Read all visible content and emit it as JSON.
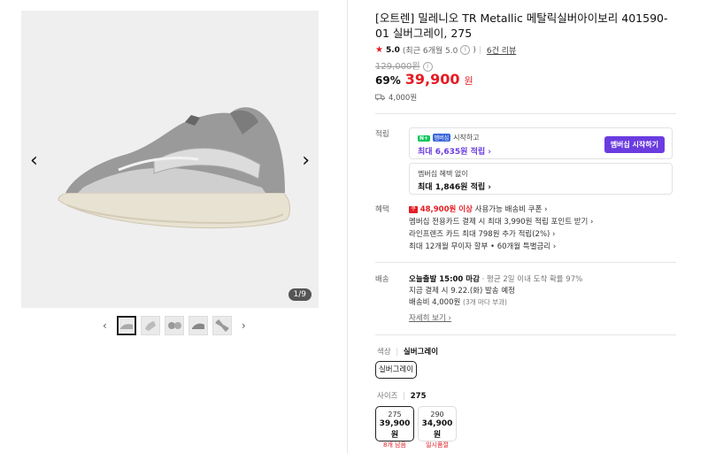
{
  "gallery": {
    "counter": "1/9",
    "prev_icon": "‹",
    "next_icon": "›",
    "thumb_prev_icon": "‹",
    "thumb_next_icon": "›",
    "thumbnail_count": 5
  },
  "product": {
    "title": "[오트렌] 밀레니오 TR Metallic 메탈릭실버아이보리 401590-01 실버그레이, 275",
    "rating_star": "★",
    "rating_score": "5.0",
    "rating_recent": "(최근 6개월 5.0",
    "rating_recent_close": ")",
    "review_link": "6건 리뷰",
    "original_price": "129,000원",
    "discount": "69%",
    "price": "39,900",
    "price_unit": "원",
    "points": "4,000원"
  },
  "accumulate": {
    "label": "적립",
    "membership_badge": "N+",
    "membership_tag": "멤버십",
    "membership_text": "시작하고",
    "membership_max": "최대 6,635원 적립 ›",
    "join_button": "멤버십 시작하기",
    "no_member_text": "멤버십 혜택 없이",
    "no_member_max": "최대 1,846원 적립 ›"
  },
  "benefits": {
    "label": "혜택",
    "coupon_tag": "쿠",
    "coupon_amount": "48,900원 이상",
    "coupon_text": "사용가능 배송비 쿠폰 ›",
    "line2": "멤버십 전용카드 결제 시 최대 3,990원 적립 포인트 받기 ›",
    "line3": "라인프렌즈 카드 최대 798원 추가 적립(2%) ›",
    "line4": "최대 12개월 무이자 할부 • 60개월 특별금리 ›"
  },
  "shipping": {
    "label": "배송",
    "today": "오늘출발 15:00 마감",
    "avg": "· 평균 2일 이내 도착 확률 97%",
    "order_now": "지금 결제 시 9.22.(화) 발송 예정",
    "fee": "배송비 4,000원",
    "fee_note": "(3개 마다 부과)",
    "details_link": "자세히 보기 ›"
  },
  "options": {
    "color_label": "색상",
    "color_value": "실버그레이",
    "color_options": [
      "실버그레이"
    ],
    "size_label": "사이즈",
    "size_value": "275",
    "sizes": [
      {
        "size": "275",
        "price": "39,900원",
        "stock": "8개 남음"
      },
      {
        "size": "290",
        "price": "34,900원",
        "stock": "일시품절"
      }
    ]
  }
}
